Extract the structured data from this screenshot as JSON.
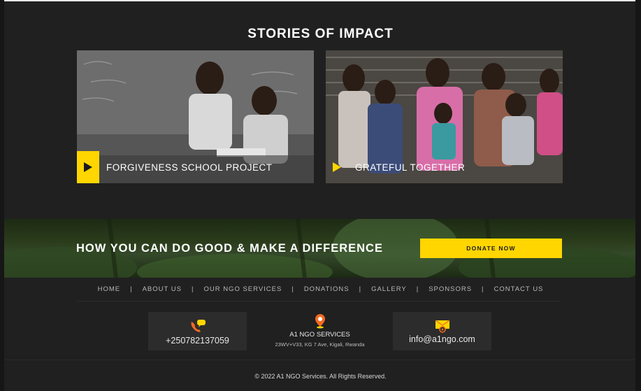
{
  "stories": {
    "title": "STORIES OF IMPACT",
    "items": [
      {
        "title": "FORGIVENESS SCHOOL PROJECT",
        "icon": "play-icon"
      },
      {
        "title": "GRATEFUL TOGETHER",
        "icon": "play-icon"
      }
    ]
  },
  "banner": {
    "headline": "HOW YOU CAN DO GOOD & MAKE A DIFFERENCE",
    "button_label": "DONATE NOW"
  },
  "footer_nav": {
    "items": [
      "HOME",
      "ABOUT US",
      "OUR NGO SERVICES",
      "DONATIONS",
      "GALLERY",
      "SPONSORS",
      "CONTACT US"
    ],
    "separator": "|"
  },
  "contact": {
    "phone": "+250782137059",
    "org_name": "A1 NGO SERVICES",
    "address": "23WV+V33, KG 7 Ave, Kigali, Rwanda",
    "email": "info@a1ngo.com"
  },
  "copyright": "©  2022  A1 NGO Services. All Rights Reserved.",
  "colors": {
    "accent": "#ffd600",
    "background": "#202020",
    "icon_orange": "#f26a21"
  }
}
